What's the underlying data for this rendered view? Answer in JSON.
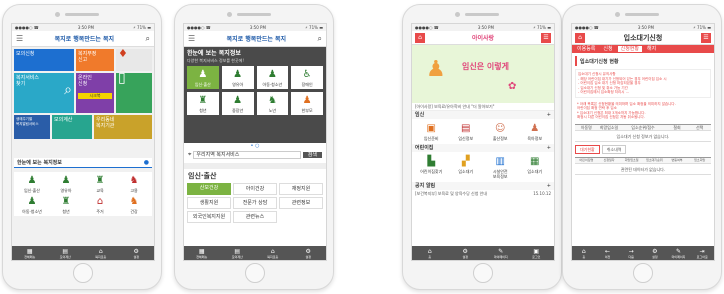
{
  "phone1": {
    "status": {
      "left": "●●●●○ ☎",
      "center": "3:50 PM",
      "right": "⚡ 71% ▬"
    },
    "logo": "복지로 행복만드는 복지",
    "tiles": [
      {
        "label": "모의신청"
      },
      {
        "label": "복지부정\n신고"
      },
      {
        "label": "복지서비스\n찾기"
      },
      {
        "label": "온라인\n신청"
      },
      {
        "label": "생애주기별\n복지알림서비스"
      },
      {
        "label": "모의계산"
      },
      {
        "label": "우리동네\n복지기관"
      }
    ],
    "tile_badge": "시크북",
    "section_title": "한눈에 보는 복지정보",
    "grid": [
      "임신·출산",
      "영유아",
      "교육",
      "고용",
      "아동·청소년",
      "청년",
      "주거",
      "건강"
    ],
    "tabs": [
      "전체메뉴",
      "모의계산",
      "복지로홈",
      "설정"
    ]
  },
  "phone2": {
    "status": {
      "left": "●●●●○ ☎",
      "center": "3:50 PM",
      "right": "⚡ 71% ▬"
    },
    "logo": "복지로 행복만드는 복지",
    "hero_title": "한눈에 보는 복지정보",
    "hero_sub": "다양한 복지서비스 정보를 한곳에!",
    "grid": [
      "임신·출산",
      "영유아",
      "아동·청소년",
      "장애인",
      "청년",
      "중장년",
      "노년",
      "한부모"
    ],
    "search_label": "우리지역 복지서비스",
    "search_button": "검색",
    "section_title": "임신·출산",
    "buttons": [
      "산모건강",
      "아이건강",
      "재정지원",
      "생활지원",
      "전문가 상담",
      "관련정보",
      "외국인복지지원",
      "관련뉴스"
    ],
    "tabs": [
      "전체메뉴",
      "모의계산",
      "복지로홈",
      "설정"
    ]
  },
  "phone3": {
    "status": {
      "left": "●●●●○ ☎",
      "center": "3:50 PM",
      "right": "⚡ 71% ▬"
    },
    "logo": "아이사랑",
    "banner_text": "임신은 이렇게",
    "notice": "[아이사랑] 보육료/유아학비 안내 \"더 알아보기\"",
    "section1": "임신",
    "icons1": [
      "임신준비",
      "임신정보",
      "출산정보",
      "육아정보"
    ],
    "section2": "어린이집",
    "icons2": [
      "어린이집찾기",
      "입소대기",
      "시설안전\n보육정보",
      "입소대기"
    ],
    "section3": "공지 알림",
    "notice2": "[보건복지부] 보육료 및 양육수당 신청 안내",
    "notice2_date": "15.10.12",
    "tabs": [
      "홈",
      "설정",
      "마이페이지",
      "로그인"
    ]
  },
  "phone4": {
    "status": {
      "left": "●●●●○ ☎",
      "center": "3:50 PM",
      "right": "⚡ 71% ▬"
    },
    "title": "입소대기신청",
    "tabs_top": [
      "이용등록",
      "신청",
      "신청현황",
      "해지"
    ],
    "section_title": "입소대기신청 현황",
    "info_lines": [
      "입소대기 신청시 유의사항",
      "- 해당 어린이집 대기가 신청되어 있는 경우 어린이집 입소 시",
      "- 어린이집 입소 대기 신청 마감되었을 경우",
      "- 입소대기 신청 및 취소 가능 기간",
      "- 어린이집에서 입소확정 처리시 ..."
    ],
    "warning_lines": [
      "* 아래 목록은 신청현황을 의미하며 입소 확정을 의미하지 않습니다.",
      "어린이집 확정 연락 후 입소",
      "* 입소대기 신청은 최대 3개소까지 가능합니다.",
      "확정시 다른 어린이집 신청은 자동 취소됩니다."
    ],
    "table_head": [
      "아동명",
      "희망입소일",
      "입소순위/점수",
      "철회",
      "선택"
    ],
    "empty_msg": "입소대기 신청 정보가 없습니다.",
    "btn_a": "대기현황",
    "btn_b": "취소내역",
    "table2_head": [
      "어린이집명",
      "신청일자",
      "희망입소일",
      "입소대기순위",
      "변동여부",
      "입소희망"
    ],
    "empty_msg2": "관련된 데이터가 없습니다.",
    "tabs": [
      "홈",
      "이전",
      "다음",
      "설정",
      "마이페이지",
      "로그아웃"
    ]
  }
}
